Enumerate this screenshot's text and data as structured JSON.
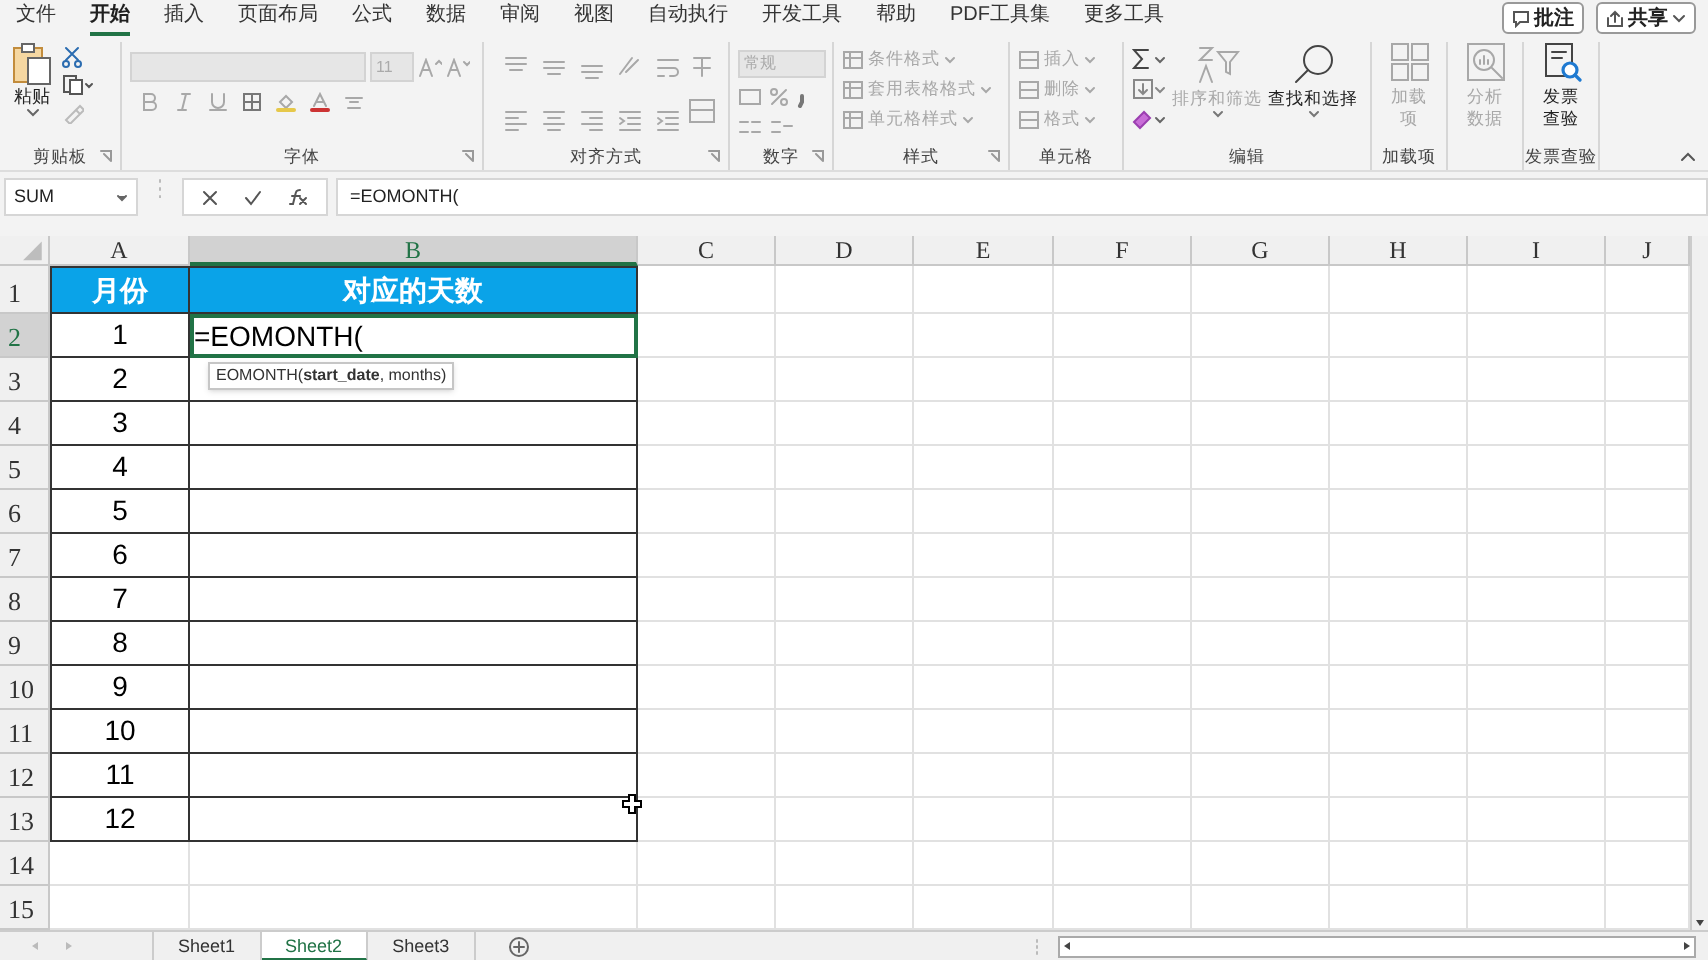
{
  "menu_tabs": [
    {
      "label": "文件",
      "selected": false
    },
    {
      "label": "开始",
      "selected": true
    },
    {
      "label": "插入",
      "selected": false
    },
    {
      "label": "页面布局",
      "selected": false
    },
    {
      "label": "公式",
      "selected": false
    },
    {
      "label": "数据",
      "selected": false
    },
    {
      "label": "审阅",
      "selected": false
    },
    {
      "label": "视图",
      "selected": false
    },
    {
      "label": "自动执行",
      "selected": false
    },
    {
      "label": "开发工具",
      "selected": false
    },
    {
      "label": "帮助",
      "selected": false
    },
    {
      "label": "PDF工具集",
      "selected": false
    },
    {
      "label": "更多工具",
      "selected": false
    }
  ],
  "header_buttons": [
    {
      "label": "批注"
    },
    {
      "label": "共享"
    }
  ],
  "ribbon": {
    "clipboard": {
      "paste": "粘贴",
      "label": "剪贴板"
    },
    "font": {
      "size": "11",
      "label": "字体"
    },
    "alignment": {
      "label": "对齐方式"
    },
    "number": {
      "format": "常规",
      "label": "数字"
    },
    "styles": {
      "label": "样式",
      "items": [
        {
          "label": "条件格式",
          "disabled": true
        },
        {
          "label": "套用表格格式",
          "disabled": true
        },
        {
          "label": "单元格样式",
          "disabled": true
        }
      ]
    },
    "cells": {
      "label": "单元格",
      "items": [
        {
          "label": "插入",
          "disabled": true
        },
        {
          "label": "删除",
          "disabled": true
        },
        {
          "label": "格式",
          "disabled": true
        }
      ]
    },
    "editing": {
      "label": "编辑",
      "items": [
        {
          "label": "排序和筛选",
          "disabled": true
        },
        {
          "label": "查找和选择",
          "disabled": false
        }
      ]
    },
    "addins": {
      "label": "加载项",
      "button": "加载项",
      "disabled": true
    },
    "analyze": {
      "button": "分析数据",
      "disabled": true
    },
    "invoice": {
      "label": "发票查验",
      "button": "发票查验",
      "disabled": false
    }
  },
  "formula_bar": {
    "name_box": "SUM",
    "formula": "=EOMONTH("
  },
  "columns": [
    "A",
    "B",
    "C",
    "D",
    "E",
    "F",
    "G",
    "H",
    "I",
    "J"
  ],
  "row_numbers": [
    "1",
    "2",
    "3",
    "4",
    "5",
    "6",
    "7",
    "8",
    "9",
    "10",
    "11",
    "12",
    "13",
    "14",
    "15"
  ],
  "table": {
    "headers": [
      "月份",
      "对应的天数"
    ],
    "rows": [
      {
        "month": "1",
        "days": "=EOMONTH("
      },
      {
        "month": "2"
      },
      {
        "month": "3"
      },
      {
        "month": "4"
      },
      {
        "month": "5"
      },
      {
        "month": "6"
      },
      {
        "month": "7"
      },
      {
        "month": "8"
      },
      {
        "month": "9"
      },
      {
        "month": "10"
      },
      {
        "month": "11"
      },
      {
        "month": "12"
      }
    ]
  },
  "tooltip": "EOMONTH(**start_date**, months)",
  "sheets": [
    {
      "label": "Sheet1",
      "selected": false
    },
    {
      "label": "Sheet2",
      "selected": true
    },
    {
      "label": "Sheet3",
      "selected": false
    }
  ]
}
